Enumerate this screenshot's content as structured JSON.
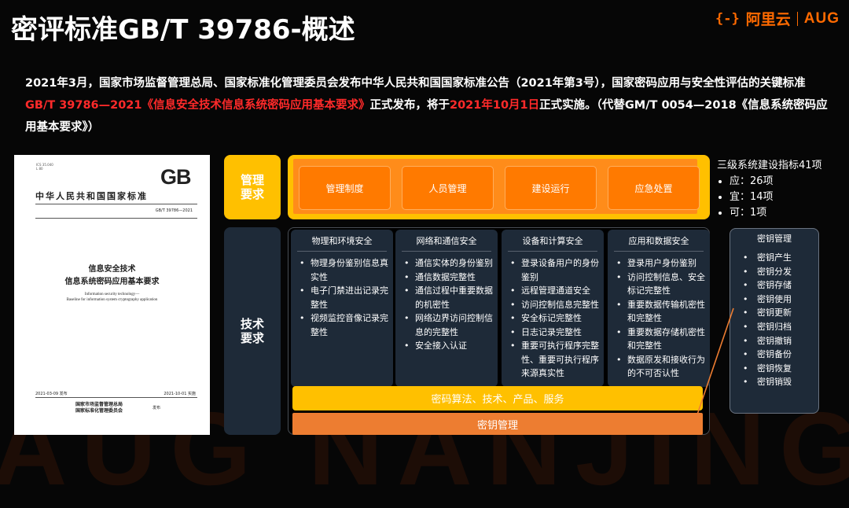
{
  "title": "密评标准GB/T 39786-概述",
  "logo": {
    "mark": "{-}",
    "brand": "阿里云",
    "sub": "AUG"
  },
  "watermark": "AUG NANJING",
  "intro": {
    "p1": "2021年3月，国家市场监督管理总局、国家标准化管理委员会发布中华人民共和国国家标准公告（2021年第3号），国家密码应用与安全性评估的关键标准",
    "red1": "GB/T 39786—2021《信息安全技术信息系统密码应用基本要求》",
    "p2": "正式发布，将于",
    "red2": "2021年10月1日",
    "p3": "正式实施。（代替GM/T 0054—2018《信息系统密码应用基本要求》）"
  },
  "document": {
    "tiny_top": "ICS 35.040",
    "tiny_top2": "L 80",
    "gb": "GB",
    "standard_org": "中华人民共和国国家标准",
    "code": "GB/T 39786—2021",
    "title_line1": "信息安全技术",
    "title_line2": "信息系统密码应用基本要求",
    "en_line1": "Information security technology—",
    "en_line2": "Baseline for information system cryptography application",
    "publish_date": "2021-03-09 发布",
    "effective_date": "2021-10-01 实施",
    "publisher_line1": "国家市场监督管理总局",
    "publisher_line2": "国家标准化管理委员会",
    "publisher_word": "发布"
  },
  "management": {
    "label": "管理\n要求",
    "items": [
      "管理制度",
      "人员管理",
      "建设运行",
      "应急处置"
    ]
  },
  "levels": {
    "heading": "三级系统建设指标41项",
    "items": [
      "应：26项",
      "宜：14项",
      "可：1项"
    ]
  },
  "technical": {
    "label": "技术\n要求",
    "columns": [
      {
        "title": "物理和环境安全",
        "items": [
          "物理身份鉴别信息真实性",
          "电子门禁进出记录完整性",
          "视频监控音像记录完整性"
        ]
      },
      {
        "title": "网络和通信安全",
        "items": [
          "通信实体的身份鉴别",
          "通信数据完整性",
          "通信过程中重要数据的机密性",
          "网络边界访问控制信息的完整性",
          "安全接入认证"
        ]
      },
      {
        "title": "设备和计算安全",
        "items": [
          "登录设备用户的身份鉴别",
          "远程管理通道安全",
          "访问控制信息完整性",
          "安全标记完整性",
          "日志记录完整性",
          "重要可执行程序完整性、重要可执行程序来源真实性"
        ]
      },
      {
        "title": "应用和数据安全",
        "items": [
          "登录用户身份鉴别",
          "访问控制信息、安全标记完整性",
          "重要数据传输机密性和完整性",
          "重要数据存储机密性和完整性",
          "数据原发和接收行为的不可否认性"
        ]
      }
    ],
    "algo_bar": "密码算法、技术、产品、服务",
    "key_bar": "密钥管理"
  },
  "key_management": {
    "title": "密钥管理",
    "items": [
      "密钥产生",
      "密钥分发",
      "密钥存储",
      "密钥使用",
      "密钥更新",
      "密钥归档",
      "密钥撤销",
      "密钥备份",
      "密钥恢复",
      "密钥销毁"
    ]
  },
  "colors": {
    "accent": "#ffc000",
    "orange": "#ff7a00",
    "key_bar": "#ed7d31",
    "red_text": "#ff2a2a",
    "panel": "#1e2a38"
  }
}
